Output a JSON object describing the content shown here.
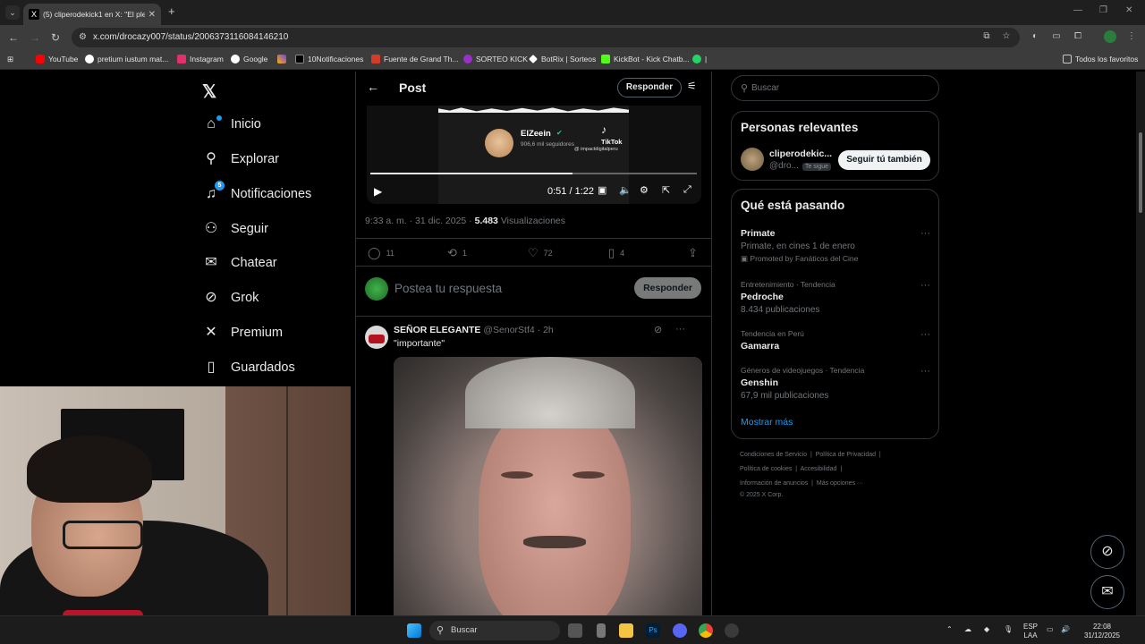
{
  "browser": {
    "tab_title": "(5) cliperodekick1 en X: \"El plen",
    "url": "x.com/drocazy007/status/2006373116084146210",
    "bookmarks": [
      {
        "label": "YouTube",
        "color": "#ff0000"
      },
      {
        "label": "pretium iustum mat...",
        "color": "#4285f4"
      },
      {
        "label": "Instagram",
        "color": "#e1306c"
      },
      {
        "label": "Google",
        "color": "#34a853"
      },
      {
        "label": "",
        "color": "#7b3fe4"
      },
      {
        "label": "10Notificaciones",
        "color": "#000000"
      },
      {
        "label": "Fuente de Grand Th...",
        "color": "#d33c2a"
      },
      {
        "label": "SORTEO KICK",
        "color": "#9b2fc9"
      },
      {
        "label": "BotRix | Sorteos",
        "color": "#ffffff"
      },
      {
        "label": "KickBot - Kick Chatb...",
        "color": "#53fc18"
      },
      {
        "label": "|",
        "color": "#25d366"
      }
    ],
    "all_bookmarks": "Todos los favoritos"
  },
  "nav": {
    "items": [
      {
        "label": "Inicio",
        "icon": "home-icon",
        "glyph": "⌂"
      },
      {
        "label": "Explorar",
        "icon": "search-icon",
        "glyph": "⚲"
      },
      {
        "label": "Notificaciones",
        "icon": "bell-icon",
        "glyph": "🔔",
        "badge": "5"
      },
      {
        "label": "Seguir",
        "icon": "follow-icon",
        "glyph": "👤"
      },
      {
        "label": "Chatear",
        "icon": "mail-icon",
        "glyph": "✉"
      },
      {
        "label": "Grok",
        "icon": "grok-icon",
        "glyph": "⊘"
      },
      {
        "label": "Premium",
        "icon": "x-icon",
        "glyph": "𝕏"
      },
      {
        "label": "Guardados",
        "icon": "bookmark-icon",
        "glyph": "🔖"
      }
    ]
  },
  "post": {
    "header_title": "Post",
    "reply_button": "Responder",
    "video": {
      "channel_name": "ElZeein",
      "followers": "906,6 mil seguidores",
      "brand": "TikTok",
      "brand_handle": "@ impactdigitalperu",
      "time": "0:51 / 1:22",
      "progress": 0.62
    },
    "time": "9:33 a. m.",
    "date": "31 dic. 2025",
    "views": "5.483",
    "views_label": "Visualizaciones",
    "stats": {
      "replies": "11",
      "reposts": "1",
      "likes": "72",
      "bookmarks": "4"
    },
    "compose_placeholder": "Postea tu respuesta",
    "compose_button": "Responder"
  },
  "reply_tweet": {
    "name": "SEÑOR ELEGANTE",
    "handle": "@SenorStf4",
    "age": "2h",
    "text": "\"importante\""
  },
  "sidebar": {
    "search_placeholder": "Buscar",
    "relevant_title": "Personas relevantes",
    "person": {
      "name": "cliperodekic...",
      "handle": "@dro...",
      "follows_you": "Te sigue",
      "follow_button": "Seguir tú también"
    },
    "trending_title": "Qué está pasando",
    "trends": [
      {
        "context": "",
        "title": "Primate",
        "sub": "Primate, en cines 1 de enero",
        "promoted": "Promoted by Fanáticos del Cine"
      },
      {
        "context": "Entretenimiento · Tendencia",
        "title": "Pedroche",
        "sub": "8.434 publicaciones"
      },
      {
        "context": "Tendencia en Perú",
        "title": "Gamarra",
        "sub": ""
      },
      {
        "context": "Géneros de videojuegos · Tendencia",
        "title": "Genshin",
        "sub": "67,9 mil publicaciones"
      }
    ],
    "show_more": "Mostrar más",
    "footer": {
      "line1a": "Condiciones de Servicio",
      "line1b": "Política de Privacidad",
      "line2a": "Política de cookies",
      "line2b": "Accesibilidad",
      "line3a": "Información de anuncios",
      "line3b": "Más opciones ···",
      "copyright": "© 2025 X Corp."
    }
  },
  "taskbar": {
    "search": "Buscar",
    "lang": "ESP",
    "lang2": "LAA",
    "clock": "22:08",
    "date": "31/12/2025"
  }
}
